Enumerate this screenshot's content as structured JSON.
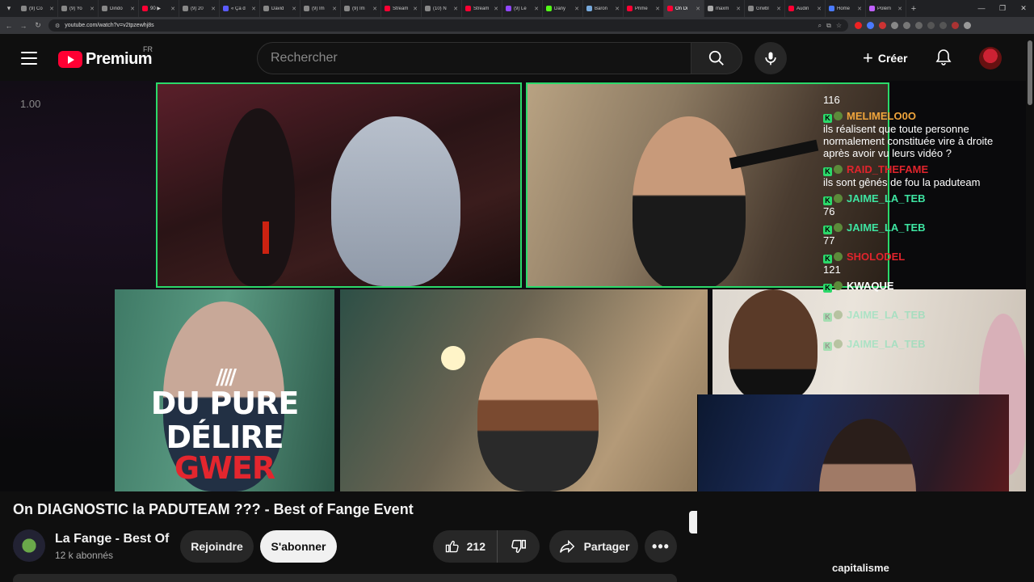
{
  "browser": {
    "tabs": [
      {
        "label": "(9) Co",
        "color": "#888888"
      },
      {
        "label": "(9) Yo",
        "color": "#888888"
      },
      {
        "label": "Dindo",
        "color": "#888888"
      },
      {
        "label": "90 ▶",
        "color": "#ff0033"
      },
      {
        "label": "(9) 20",
        "color": "#888888"
      },
      {
        "label": "« Ça d",
        "color": "#5b5bff"
      },
      {
        "label": "David",
        "color": "#888888"
      },
      {
        "label": "(9) Im",
        "color": "#888888"
      },
      {
        "label": "(9) Im",
        "color": "#888888"
      },
      {
        "label": "Stream",
        "color": "#ff0033"
      },
      {
        "label": "(10) N",
        "color": "#888888"
      },
      {
        "label": "Stream",
        "color": "#ff0033"
      },
      {
        "label": "(9) Le",
        "color": "#9146ff"
      },
      {
        "label": "Dany",
        "color": "#53fc18"
      },
      {
        "label": "Baron",
        "color": "#7ad"
      },
      {
        "label": "Prime",
        "color": "#ff0033"
      },
      {
        "label": "On Di",
        "color": "#ff0033"
      },
      {
        "label": "maxm",
        "color": "#aaa"
      },
      {
        "label": "Grwbl",
        "color": "#888888"
      },
      {
        "label": "Audin",
        "color": "#ff0033"
      },
      {
        "label": "Home",
        "color": "#4a7aff"
      },
      {
        "label": "Polém",
        "color": "#c060ff"
      }
    ],
    "active_tab_index": 16,
    "url": "youtube.com/watch?v=v2tpzewhj8s"
  },
  "header": {
    "logo_text": "Premium",
    "country": "FR",
    "search_placeholder": "Rechercher",
    "create_label": "Créer"
  },
  "video": {
    "speed": "1.00",
    "overlay_line1": "DU PURE",
    "overlay_line2a": "DÉLIRE ",
    "overlay_line2b": "GWER",
    "overlay_slashes": "////",
    "caption": "capitalisme"
  },
  "chat": {
    "messages": [
      {
        "user": "",
        "text": "116",
        "color": "c-white",
        "badges": false
      },
      {
        "user": "MELIMELO0O",
        "text": "ils réalisent que toute personne normalement constituée vire à droite après avoir vu leurs vidéo ?",
        "color": "c-gold",
        "badges": true
      },
      {
        "user": "RAID_THEFAME",
        "text": "ils sont gênés de fou la paduteam",
        "color": "c-red",
        "badges": true
      },
      {
        "user": "JAIME_LA_TEB",
        "text": "76",
        "color": "c-green",
        "badges": true
      },
      {
        "user": "JAIME_LA_TEB",
        "text": "77",
        "color": "c-green",
        "badges": true
      },
      {
        "user": "SHOLODEL",
        "text": "121",
        "color": "c-red",
        "badges": true
      },
      {
        "user": "KWAQUE",
        "text": "",
        "color": "c-white",
        "badges": true
      },
      {
        "user": "JAIME_LA_TEB",
        "text": "",
        "color": "c-green",
        "badges": true
      },
      {
        "user": "JAIME_LA_TEB",
        "text": "",
        "color": "c-green",
        "badges": true
      }
    ]
  },
  "meta": {
    "title": "On DIAGNOSTIC la PADUTEAM ??? - Best of Fange Event",
    "channel_name": "La Fange - Best Of",
    "subscribers": "12 k abonnés",
    "join_label": "Rejoindre",
    "subscribe_label": "S'abonner",
    "like_count": "212",
    "share_label": "Partager"
  }
}
